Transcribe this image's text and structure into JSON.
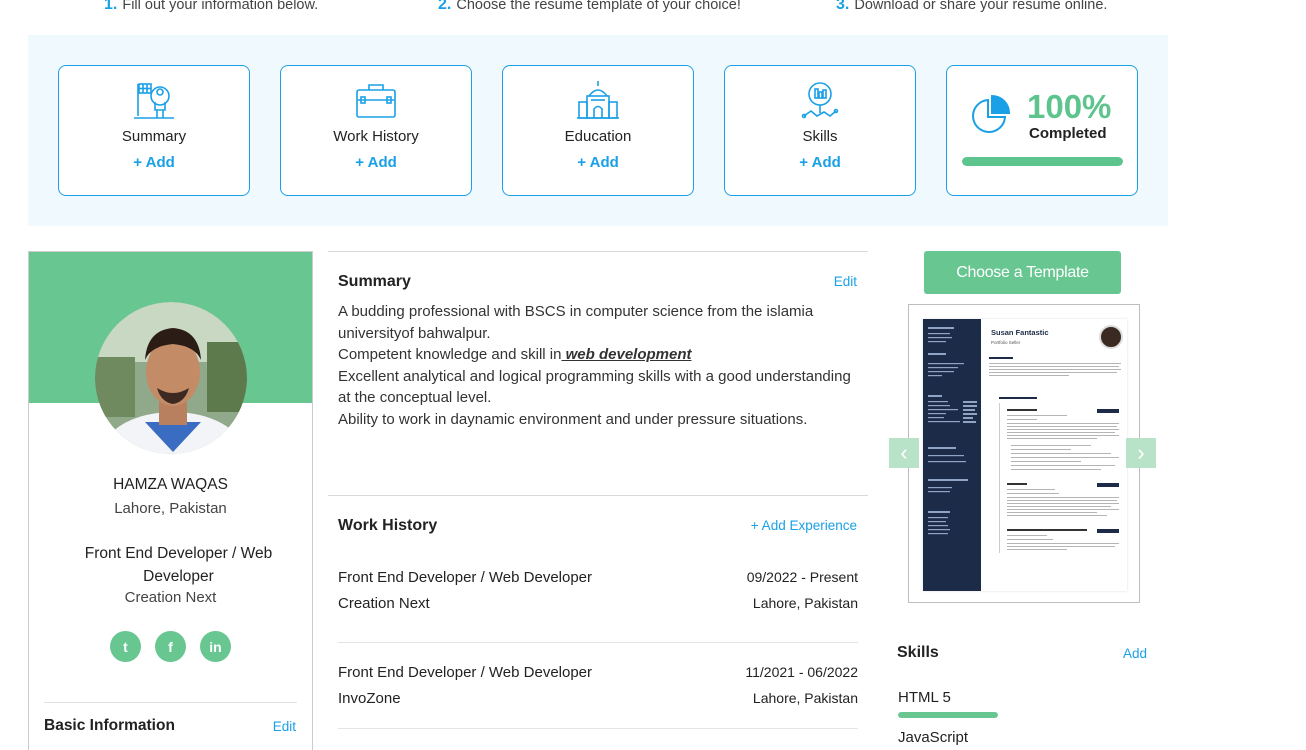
{
  "steps": [
    {
      "num": "1.",
      "text": "Fill out your information below."
    },
    {
      "num": "2.",
      "text": "Choose the resume template of your choice!"
    },
    {
      "num": "3.",
      "text": "Download or share your resume online."
    }
  ],
  "sections": [
    {
      "title": "Summary",
      "action": "+ Add",
      "icon": "summary-flag-person-icon"
    },
    {
      "title": "Work History",
      "action": "+ Add",
      "icon": "briefcase-icon"
    },
    {
      "title": "Education",
      "action": "+ Add",
      "icon": "school-building-icon"
    },
    {
      "title": "Skills",
      "action": "+ Add",
      "icon": "skills-magnifier-icon"
    }
  ],
  "progress": {
    "percent_label": "100%",
    "label": "Completed",
    "value": 1.0,
    "icon": "pie-chart-icon"
  },
  "profile": {
    "name": "HAMZA WAQAS",
    "location": "Lahore,  Pakistan",
    "role": "Front End Developer / Web Developer",
    "company": "Creation Next",
    "socials": [
      {
        "name": "twitter",
        "glyph": "t"
      },
      {
        "name": "facebook",
        "glyph": "f"
      },
      {
        "name": "linkedin",
        "glyph": "in"
      }
    ],
    "basic_info_title": "Basic Information",
    "basic_info_edit": "Edit"
  },
  "summary": {
    "title": "Summary",
    "edit": "Edit",
    "line1": "A budding professional with BSCS in computer science  from the islamia universityof bahwalpur.",
    "line2_prefix": "Competent knowledge and skill in",
    "line2_emphasis": " web development",
    "line3": "Excellent analytical and logical programming skills with a good understanding at the conceptual level.",
    "line4": "Ability to work in daynamic environment and under pressure situations."
  },
  "work_history": {
    "title": "Work History",
    "add": "+ Add Experience",
    "jobs": [
      {
        "title": "Front End Developer / Web Developer",
        "dates": "09/2022 - Present",
        "company": "Creation Next",
        "location": "Lahore, Pakistan"
      },
      {
        "title": "Front End Developer / Web Developer",
        "dates": "11/2021 - 06/2022",
        "company": "InvoZone",
        "location": "Lahore, Pakistan"
      }
    ]
  },
  "template": {
    "button": "Choose a Template",
    "preview_name": "Susan Fantastic",
    "preview_subtitle": "Portfolio Seller",
    "prev_icon": "chevron-left-icon",
    "next_icon": "chevron-right-icon"
  },
  "skills": {
    "title": "Skills",
    "add": "Add",
    "items": [
      {
        "name": "HTML 5",
        "level": 1.0
      },
      {
        "name": "JavaScript",
        "level": 1.0
      }
    ]
  },
  "colors": {
    "accent_blue": "#1aa0e6",
    "accent_green": "#68c691",
    "progress_green": "#5ec48e",
    "panel_bg": "#f0f9fd",
    "template_navy": "#1b2b48"
  }
}
